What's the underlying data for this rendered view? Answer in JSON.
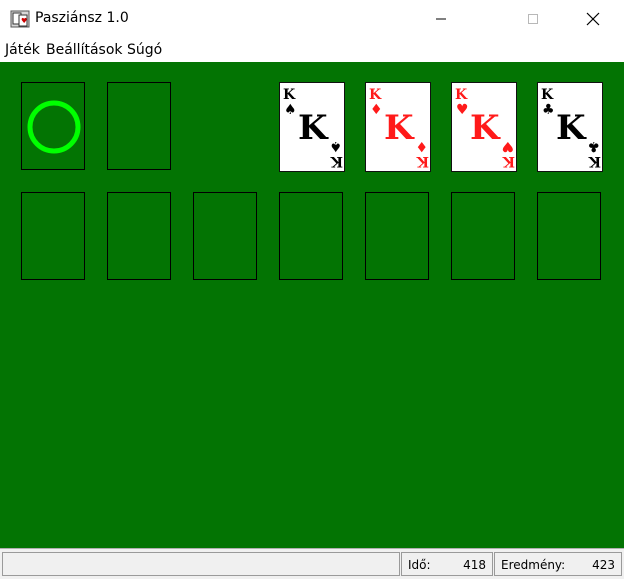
{
  "window": {
    "title": "Pasziánsz 1.0"
  },
  "menu": [
    {
      "label": "Játék"
    },
    {
      "label": "Beállítások"
    },
    {
      "label": "Súgó"
    }
  ],
  "foundations": [
    {
      "rank": "K",
      "suit": "spades",
      "symbol": "♠",
      "color": "#000000"
    },
    {
      "rank": "K",
      "suit": "diamonds",
      "symbol": "♦",
      "color": "#ff1a1a"
    },
    {
      "rank": "K",
      "suit": "hearts",
      "symbol": "♥",
      "color": "#ff1a1a"
    },
    {
      "rank": "K",
      "suit": "clubs",
      "symbol": "♣",
      "color": "#000000"
    }
  ],
  "status": {
    "message": "",
    "time_label": "Idő:",
    "time_value": "418",
    "score_label": "Eredmény:",
    "score_value": "423"
  },
  "colors": {
    "felt": "#037403",
    "recycle_ring": "#00ff00",
    "red_suit": "#ff1a1a"
  }
}
